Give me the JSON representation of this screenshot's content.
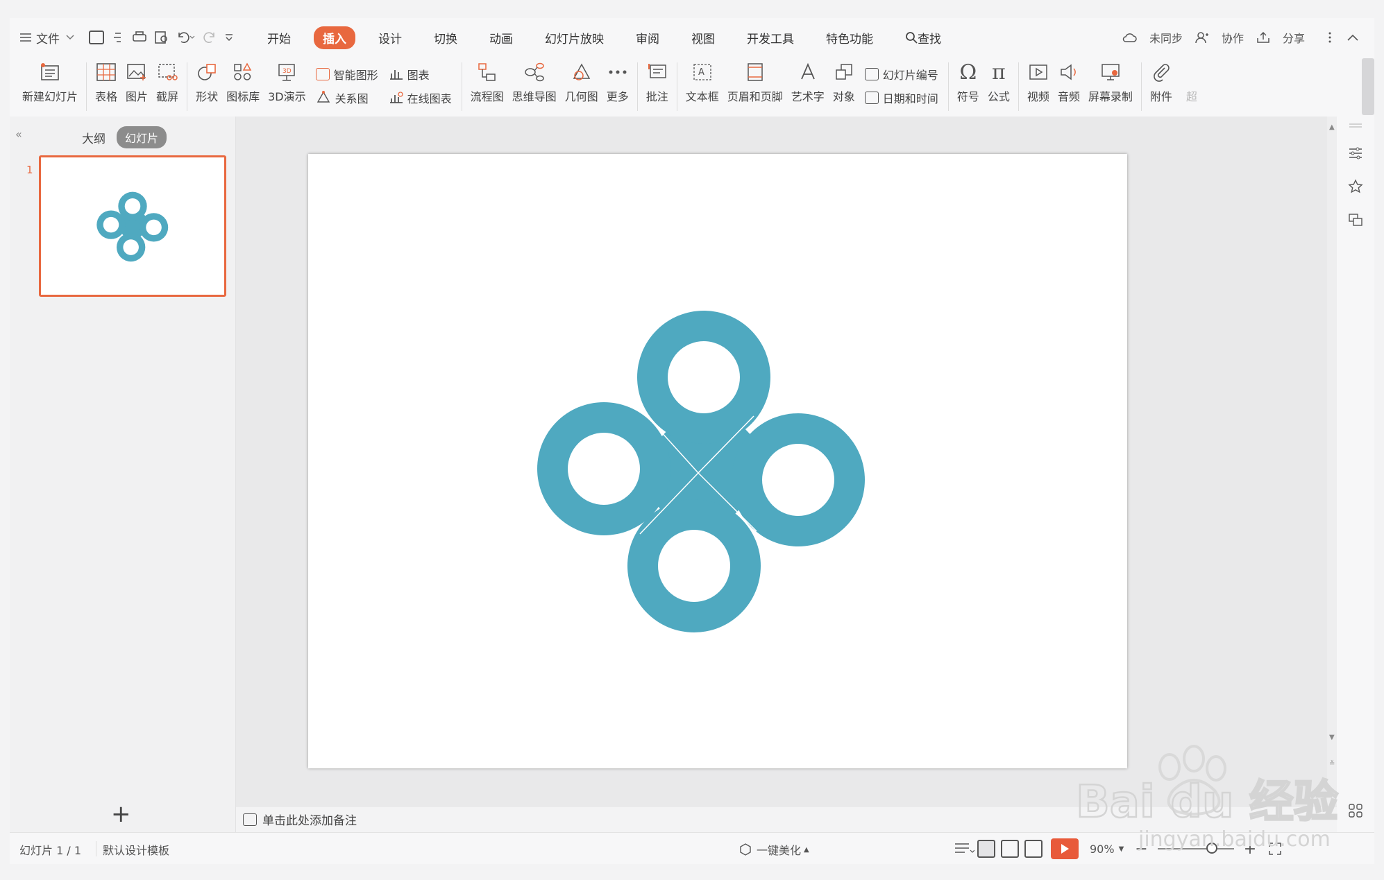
{
  "menu": {
    "hamburger_icon": "menu-icon",
    "file_label": "文件",
    "tabs": [
      {
        "label": "开始"
      },
      {
        "label": "插入",
        "active": true
      },
      {
        "label": "设计"
      },
      {
        "label": "切换"
      },
      {
        "label": "动画"
      },
      {
        "label": "幻灯片放映"
      },
      {
        "label": "审阅"
      },
      {
        "label": "视图"
      },
      {
        "label": "开发工具"
      },
      {
        "label": "特色功能"
      }
    ],
    "search_label": "查找",
    "unsync_label": "未同步",
    "collab_label": "协作",
    "share_label": "分享"
  },
  "ribbon": {
    "new_slide": "新建幻灯片",
    "table": "表格",
    "picture": "图片",
    "screenshot": "截屏",
    "shape": "形状",
    "icon_lib": "图标库",
    "demo3d": "3D演示",
    "smart_art": "智能图形",
    "chart": "图表",
    "relation": "关系图",
    "online_chart": "在线图表",
    "flowchart": "流程图",
    "mindmap": "思维导图",
    "geometry": "几何图",
    "more": "更多",
    "comment": "批注",
    "textbox": "文本框",
    "header_footer": "页眉和页脚",
    "wordart": "艺术字",
    "object": "对象",
    "slide_number": "幻灯片编号",
    "datetime": "日期和时间",
    "symbol": "符号",
    "formula": "公式",
    "video": "视频",
    "audio": "音频",
    "screen_record": "屏幕录制",
    "attachment": "附件",
    "hyperlink_partial": "超"
  },
  "left_panel": {
    "outline_tab": "大纲",
    "slides_tab": "幻灯片",
    "slide_number": "1",
    "add_label": "+"
  },
  "notes": {
    "placeholder": "单击此处添加备注"
  },
  "status": {
    "slide_counter": "幻灯片 1 / 1",
    "template": "默认设计模板",
    "beautify": "一键美化",
    "zoom": "90%"
  },
  "watermark": {
    "brand": "Bai du 经验",
    "url": "jingyan.baidu.com"
  },
  "colors": {
    "accent": "#e8683f",
    "shape_fill": "#4fa9c0"
  }
}
